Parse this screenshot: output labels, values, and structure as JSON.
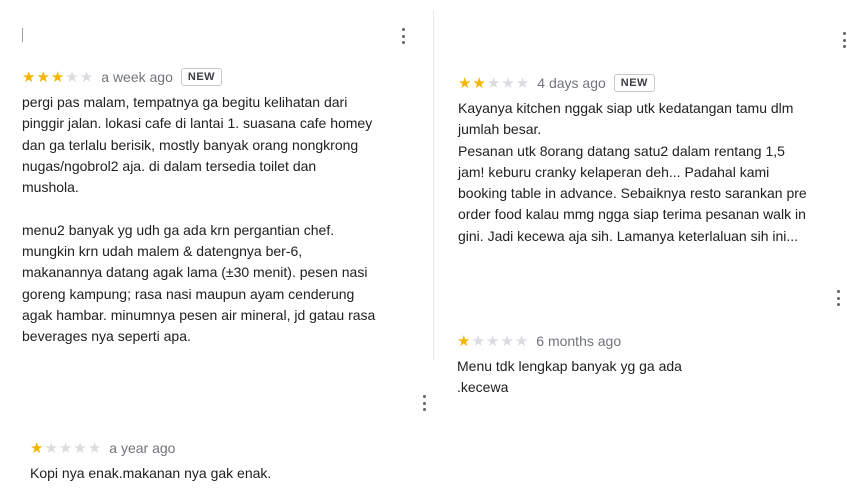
{
  "reviews": [
    {
      "rating": 3,
      "age": "a week ago",
      "badge": "NEW",
      "text": "pergi pas malam, tempatnya ga begitu kelihatan dari\npinggir jalan. lokasi cafe di lantai 1. suasana cafe homey\ndan ga terlalu berisik, mostly banyak orang nongkrong\nnugas/ngobrol2 aja. di dalam tersedia toilet dan\nmushola.\n\nmenu2 banyak yg udh ga ada krn pergantian chef.\nmungkin krn udah malem & datengnya ber-6,\nmakanannya datang agak lama (±30 menit). pesen nasi\ngoreng kampung; rasa nasi maupun ayam cenderung\nagak hambar. minumnya pesen air mineral, jd gatau rasa\nbeverages nya seperti apa."
    },
    {
      "rating": 2,
      "age": "4 days ago",
      "badge": "NEW",
      "text": "Kayanya kitchen nggak siap utk kedatangan tamu dlm\njumlah besar.\nPesanan utk 8orang datang satu2 dalam rentang 1,5\njam! keburu cranky kelaperan deh... Padahal kami\nbooking table in advance. Sebaiknya resto sarankan pre\norder food kalau mmg ngga siap terima pesanan walk in\ngini. Jadi kecewa aja sih. Lamanya keterlaluan sih ini..."
    },
    {
      "rating": 1,
      "age": "6 months ago",
      "text": "Menu tdk lengkap banyak yg ga ada\n.kecewa"
    },
    {
      "rating": 1,
      "age": "a year ago",
      "text": "Kopi nya enak.makanan nya gak enak."
    }
  ],
  "icons": {
    "star": "star-icon",
    "menu": "more-vert-icon"
  },
  "colors": {
    "star_on": "#f5b400",
    "star_off": "#dadce0"
  }
}
